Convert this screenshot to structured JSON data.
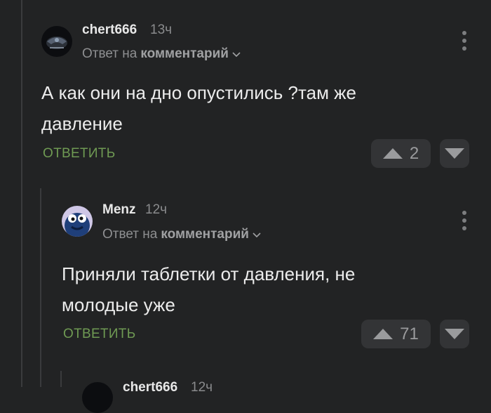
{
  "comments": [
    {
      "author": "chert666",
      "time": "13ч",
      "reply_prefix": "Ответ на",
      "reply_target": "комментарий",
      "text_lines": [
        "А как они на дно опустились ?там же",
        "давление"
      ],
      "reply_label": "ответить",
      "votes": "2"
    },
    {
      "author": "Menz",
      "time": "12ч",
      "reply_prefix": "Ответ на",
      "reply_target": "комментарий",
      "text_lines": [
        "Приняли таблетки от давления, не",
        "молодые уже"
      ],
      "reply_label": "ответить",
      "votes": "71"
    },
    {
      "author": "chert666",
      "time": "12ч"
    }
  ],
  "icons": {
    "more": "vertical-dots-icon",
    "chevron": "chevron-down-icon",
    "upvote": "triangle-up-icon",
    "downvote": "triangle-down-icon"
  },
  "colors": {
    "background": "#222324",
    "reply_green": "#6f9a53",
    "vote_bg": "#333436"
  }
}
